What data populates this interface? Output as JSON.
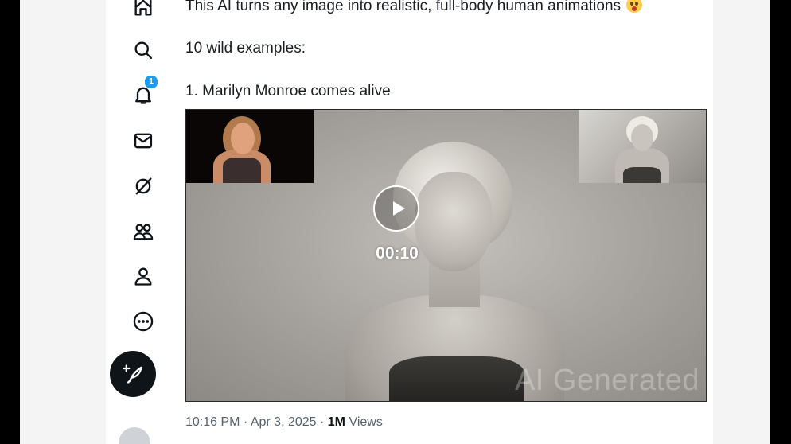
{
  "nav": {
    "items": [
      {
        "name": "home",
        "icon": "home-icon"
      },
      {
        "name": "search",
        "icon": "search-icon"
      },
      {
        "name": "notifications",
        "icon": "bell-icon",
        "badge": "1"
      },
      {
        "name": "messages",
        "icon": "mail-icon"
      },
      {
        "name": "grok",
        "icon": "grok-icon"
      },
      {
        "name": "communities",
        "icon": "people-icon"
      },
      {
        "name": "profile",
        "icon": "person-icon"
      },
      {
        "name": "more",
        "icon": "more-circle-icon"
      }
    ],
    "compose_icon": "feather-plus-icon",
    "accent": "#1d9bf0"
  },
  "post": {
    "line1": "This AI turns any image into realistic, full-body human animations",
    "line1_emoji": "astonished-face-emoji",
    "line2": "10 wild examples:",
    "line3": "1. Marilyn Monroe comes alive",
    "video": {
      "duration": "00:10",
      "watermark": "AI Generated"
    },
    "timestamp": "10:16 PM · Apr 3, 2025 · ",
    "views_count": "1M",
    "views_label": " Views"
  }
}
